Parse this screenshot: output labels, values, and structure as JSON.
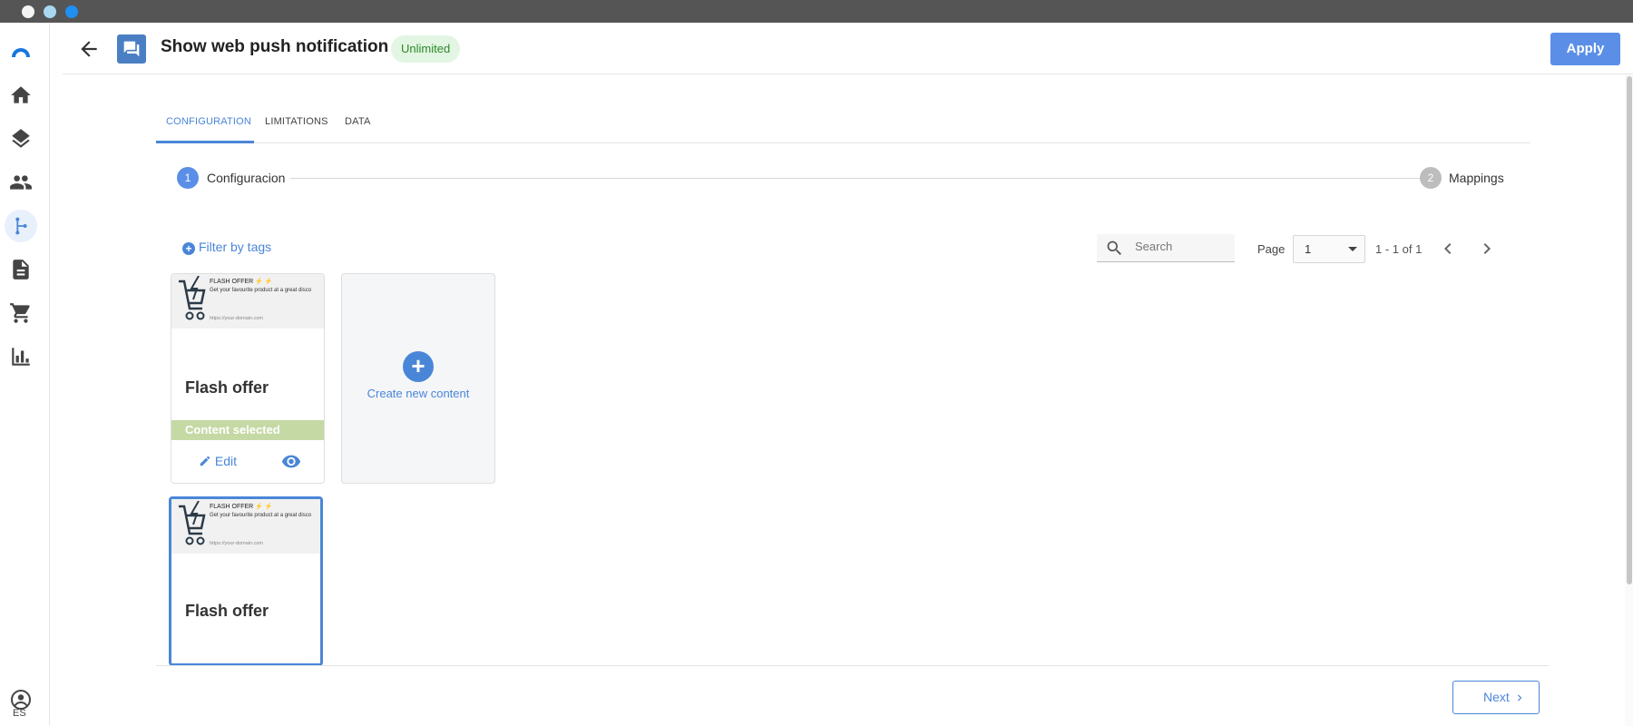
{
  "header": {
    "title": "Show web push notification",
    "badge": "Unlimited",
    "apply_label": "Apply"
  },
  "tabs": [
    {
      "label": "CONFIGURATION",
      "active": true
    },
    {
      "label": "LIMITATIONS",
      "active": false
    },
    {
      "label": "DATA",
      "active": false
    }
  ],
  "stepper": [
    {
      "number": "1",
      "label": "Configuracion",
      "active": true
    },
    {
      "number": "2",
      "label": "Mappings",
      "active": false
    }
  ],
  "toolbar": {
    "filter_label": "Filter by tags",
    "search_placeholder": "Search",
    "page_label": "Page",
    "page_value": "1",
    "range": "1 - 1 of 1"
  },
  "cards": [
    {
      "title": "Flash offer",
      "thumb_title": "FLASH OFFER",
      "thumb_desc": "Get your favourite product at a great disco",
      "thumb_url": "https://your-domain.com",
      "status": "Content selected",
      "edit_label": "Edit"
    },
    {
      "title": "Flash offer",
      "thumb_title": "FLASH OFFER",
      "thumb_desc": "Get your favourite product at a great disco",
      "thumb_url": "https://your-domain.com"
    }
  ],
  "create_label": "Create new content",
  "footer": {
    "next_label": "Next"
  },
  "sidebar": {
    "language": "ES",
    "items": [
      "home-icon",
      "layers-icon",
      "people-icon",
      "flow-icon",
      "document-icon",
      "cart-icon",
      "chart-icon"
    ]
  },
  "colors": {
    "accent": "#4a86d8",
    "apply": "#5b8ee6",
    "selected_bar": "#c5d9a5",
    "badge_bg": "#e3f5e3",
    "badge_text": "#2a8a2a"
  }
}
